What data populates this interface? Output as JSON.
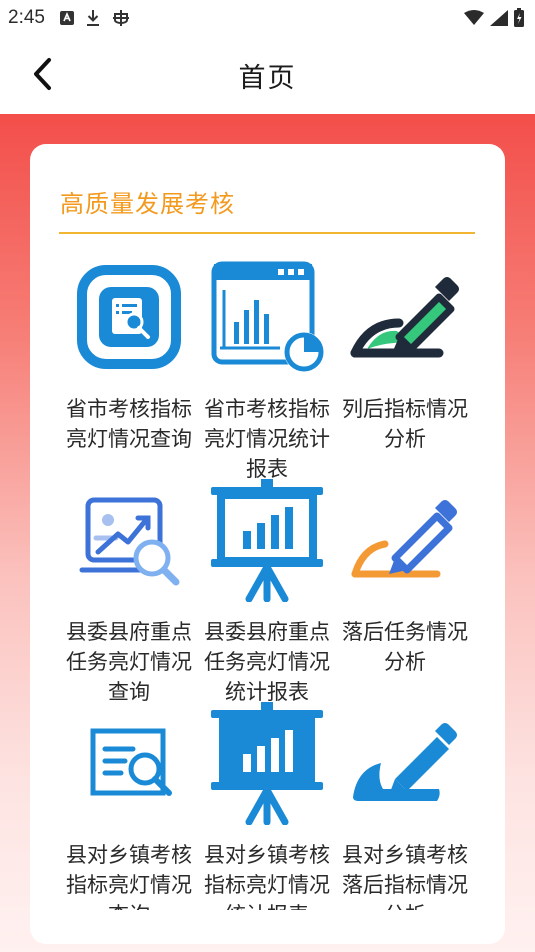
{
  "status_bar": {
    "time": "2:45"
  },
  "header": {
    "title": "首页"
  },
  "section": {
    "title": "高质量发展考核"
  },
  "tiles": [
    {
      "line1": "省市考核指标",
      "line2": "亮灯情况查询",
      "line3": "",
      "icon": "search-document-icon"
    },
    {
      "line1": "省市考核指标",
      "line2": "亮灯情况统计",
      "line3": "报表",
      "icon": "bar-report-icon"
    },
    {
      "line1": "列后指标情况",
      "line2": "分析",
      "line3": "",
      "icon": "pen-check-icon"
    },
    {
      "line1": "县委县府重点",
      "line2": "任务亮灯情况",
      "line3": "查询",
      "icon": "trend-search-icon"
    },
    {
      "line1": "县委县府重点",
      "line2": "任务亮灯情况",
      "line3": "统计报表",
      "icon": "presentation-chart-icon"
    },
    {
      "line1": "落后任务情况",
      "line2": "分析",
      "line3": "",
      "icon": "pen-line-icon"
    },
    {
      "line1": "县对乡镇考核",
      "line2": "指标亮灯情况",
      "line3": "查询",
      "icon": "document-magnifier-icon"
    },
    {
      "line1": "县对乡镇考核",
      "line2": "指标亮灯情况",
      "line3": "统计报表",
      "icon": "presentation-solid-icon"
    },
    {
      "line1": "县对乡镇考核",
      "line2": "落后指标情况",
      "line3": "分析",
      "icon": "pen-solid-icon"
    }
  ],
  "colors": {
    "primary_blue": "#1a8ad6",
    "accent_orange": "#f39a1e",
    "header_red": "#f34e4a",
    "green": "#35c77c"
  }
}
